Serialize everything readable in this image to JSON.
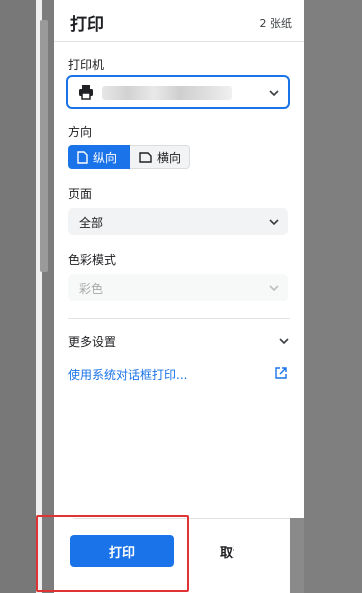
{
  "header": {
    "title": "打印",
    "sheets": "2 张纸"
  },
  "printer": {
    "label": "打印机",
    "icon": "printer-icon"
  },
  "orientation": {
    "label": "方向",
    "portrait_label": "纵向",
    "landscape_label": "横向",
    "selected": "纵向"
  },
  "pages": {
    "label": "页面",
    "value": "全部"
  },
  "color_mode": {
    "label": "色彩模式",
    "value": "彩色",
    "disabled": true
  },
  "more_settings": {
    "label": "更多设置"
  },
  "system_dialog": {
    "label": "使用系统对话框打印..."
  },
  "footer": {
    "print_label": "打印",
    "cancel_label": "取消"
  },
  "colors": {
    "accent": "#1a73e8",
    "highlight": "#e03434"
  }
}
